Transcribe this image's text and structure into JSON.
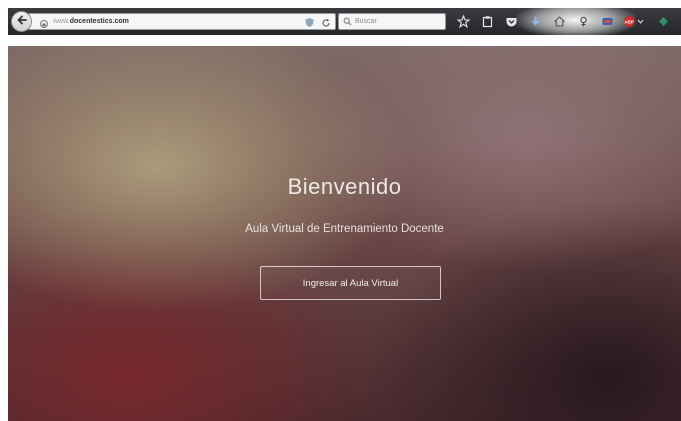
{
  "browser": {
    "url_prefix": "www.",
    "url_domain": "docentestics.com",
    "search_placeholder": "Buscar",
    "icons": [
      "back-arrow-icon",
      "identity-icon",
      "shield-icon",
      "reload-icon",
      "search-icon",
      "star-icon",
      "clipboard-icon",
      "pocket-icon",
      "download-icon",
      "home-icon",
      "addon-icon",
      "vpn-icon",
      "abp-icon",
      "extension-icon",
      "menu-icon"
    ],
    "abp_label": "ABP"
  },
  "page": {
    "title": "Bienvenido",
    "subtitle": "Aula Virtual de Entrenamiento Docente",
    "button_label": "Ingresar al Aula Virtual"
  },
  "colors": {
    "toolbar": "#2f3135",
    "hero_dark": "#4a2a2e",
    "hero_light": "#b6a880",
    "text": "#ffffff"
  }
}
